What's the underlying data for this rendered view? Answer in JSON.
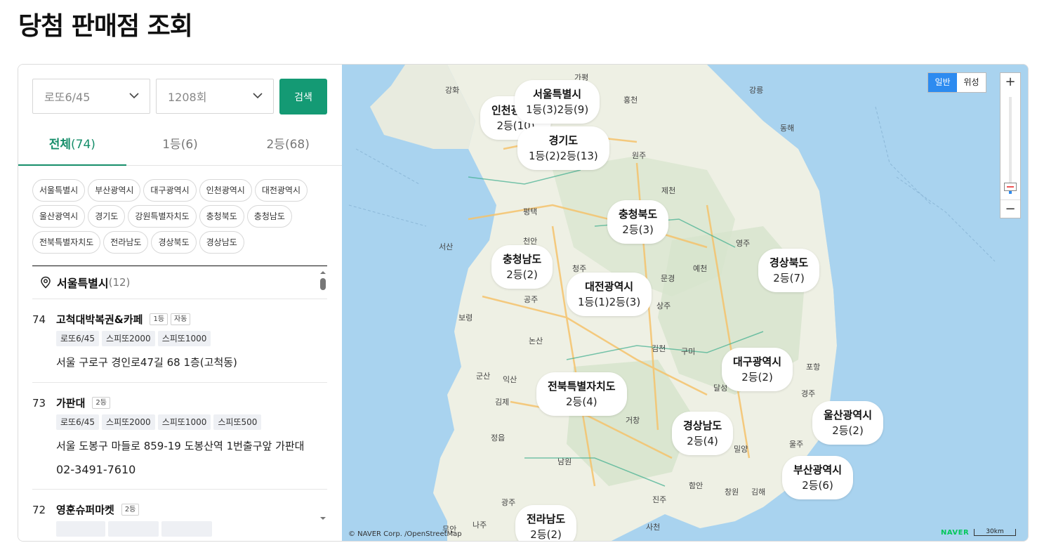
{
  "page": {
    "title": "당첨 판매점 조회"
  },
  "filters": {
    "game": "로또6/45",
    "round": "1208회",
    "search_label": "검색"
  },
  "tabs": [
    {
      "label": "전체",
      "count": "(74)"
    },
    {
      "label": "1등",
      "count": "(6)"
    },
    {
      "label": "2등",
      "count": "(68)"
    }
  ],
  "regions": [
    "서울특별시",
    "부산광역시",
    "대구광역시",
    "인천광역시",
    "대전광역시",
    "울산광역시",
    "경기도",
    "강원특별자치도",
    "충청북도",
    "충청남도",
    "전북특별자치도",
    "전라남도",
    "경상북도",
    "경상남도"
  ],
  "list": {
    "region_name": "서울특별시",
    "region_count": "(12)",
    "stores": [
      {
        "num": "74",
        "name": "고척대박복권&카페",
        "badges": [
          "1등",
          "자동"
        ],
        "games": [
          "로또6/45",
          "스피또2000",
          "스피또1000"
        ],
        "address": "서울 구로구 경인로47길 68 1층(고척동)",
        "phone": ""
      },
      {
        "num": "73",
        "name": "가판대",
        "badges": [
          "2등"
        ],
        "games": [
          "로또6/45",
          "스피또2000",
          "스피또1000",
          "스피또500"
        ],
        "address": "서울 도봉구 마들로 859-19 도봉산역 1번출구앞 가판대",
        "phone": "02-3491-7610"
      },
      {
        "num": "72",
        "name": "영훈슈퍼마켓",
        "badges": [
          "2등"
        ],
        "games": [],
        "address": "",
        "phone": ""
      }
    ]
  },
  "map": {
    "type_options": [
      "일반",
      "위성"
    ],
    "active_type": "일반",
    "zoom_in": "+",
    "zoom_out": "−",
    "copyright": "© NAVER Corp. /OpenStreetMap",
    "brand": "NAVER",
    "scale": "30km",
    "colors": {
      "sea": "#a9d3ef",
      "land": "#eef0e4",
      "accent": "#149a74",
      "selected_tab": "#168e6a"
    },
    "markers": [
      {
        "name": "서울특별시",
        "count": "1등(3)2등(9)"
      },
      {
        "name": "인천광역시",
        "count": "2등(10)"
      },
      {
        "name": "경기도",
        "count": "1등(2)2등(13)"
      },
      {
        "name": "충청북도",
        "count": "2등(3)"
      },
      {
        "name": "충청남도",
        "count": "2등(2)"
      },
      {
        "name": "대전광역시",
        "count": "1등(1)2등(3)"
      },
      {
        "name": "경상북도",
        "count": "2등(7)"
      },
      {
        "name": "대구광역시",
        "count": "2등(2)"
      },
      {
        "name": "전북특별자치도",
        "count": "2등(4)"
      },
      {
        "name": "울산광역시",
        "count": "2등(2)"
      },
      {
        "name": "경상남도",
        "count": "2등(4)"
      },
      {
        "name": "부산광역시",
        "count": "2등(6)"
      },
      {
        "name": "전라남도",
        "count": "2등(2)"
      }
    ],
    "place_labels": [
      "강화",
      "가평",
      "홍천",
      "강릉",
      "동해",
      "원주",
      "제천",
      "평택",
      "천안",
      "서산",
      "청주",
      "영주",
      "예천",
      "문경",
      "공주",
      "보령",
      "상주",
      "김천",
      "구미",
      "포항",
      "논산",
      "익산",
      "군산",
      "김제",
      "경주",
      "달성",
      "정읍",
      "거창",
      "밀양",
      "울주",
      "남원",
      "진주",
      "함안",
      "창원",
      "김해",
      "광주",
      "나주",
      "무안",
      "사천"
    ]
  }
}
